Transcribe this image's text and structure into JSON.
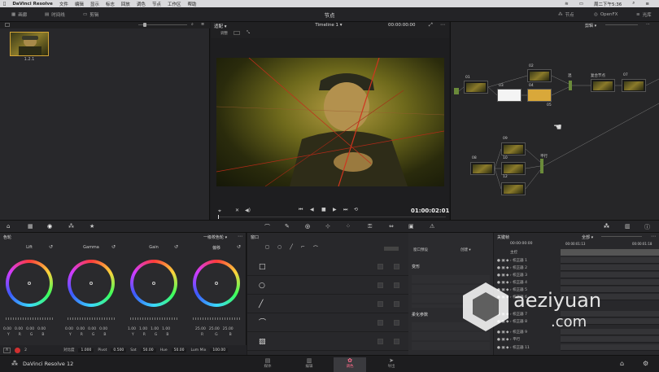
{
  "menubar": {
    "app": "DaVinci Resolve",
    "items": [
      "文件",
      "编辑",
      "显示",
      "标志",
      "回放",
      "调色",
      "节点",
      "工作区",
      "帮助"
    ],
    "clock": "周二下午5:36"
  },
  "topbar": {
    "media_pool": "画廊",
    "timeline": "时间线",
    "clips": "剪辑",
    "title": "节点",
    "nodes_btn": "节点",
    "openfx": "OpenFX",
    "library": "光库"
  },
  "gallery": {
    "thumb_label": "1.2.1"
  },
  "viewer": {
    "fit": "适配",
    "timeline_name": "Timeline 1",
    "timecode_top": "00:00:00:00",
    "timecode": "01:00:02:01",
    "clip_label": "调整"
  },
  "nodes_panel": {
    "mode": "剪辑",
    "labels": [
      "01",
      "02",
      "03",
      "04",
      "05",
      "06",
      "07",
      "08",
      "09",
      "10",
      "11",
      "12",
      "13"
    ],
    "text_labels": [
      "混",
      "复合节点",
      "平行"
    ]
  },
  "color_wheels": {
    "title": "色轮",
    "mode": "一级校色轮",
    "wheels": [
      {
        "name": "Lift",
        "vals": [
          "0.00",
          "0.00",
          "0.00",
          "0.00"
        ],
        "keys": [
          "Y",
          "R",
          "G",
          "B"
        ]
      },
      {
        "name": "Gamma",
        "vals": [
          "0.00",
          "0.00",
          "0.00",
          "0.00"
        ],
        "keys": [
          "Y",
          "R",
          "G",
          "B"
        ]
      },
      {
        "name": "Gain",
        "vals": [
          "1.00",
          "1.00",
          "1.00",
          "1.00"
        ],
        "keys": [
          "Y",
          "R",
          "G",
          "B"
        ]
      },
      {
        "name": "偏移",
        "vals": [
          "25.00",
          "25.00",
          "25.00"
        ],
        "keys": [
          "R",
          "G",
          "B"
        ]
      }
    ],
    "params": {
      "page_a": "A",
      "page_num": "2",
      "contrast_label": "对比度",
      "contrast": "1.000",
      "pivot_label": "Pivot",
      "pivot": "0.500",
      "sat_label": "Sat",
      "sat": "50.00",
      "hue_label": "Hue",
      "hue": "50.00",
      "lum_label": "Lum Mix",
      "lum": "100.00"
    }
  },
  "window_panel": {
    "title": "窗口",
    "transform": "变形",
    "softness": "柔化参数",
    "preset": "窗口预设",
    "create": "创建"
  },
  "keyframes": {
    "title": "关键帧",
    "filter": "全部",
    "tc_start": "00:00:00:00",
    "tc_a": "00:00:01:13",
    "tc_b": "00:00:01:18",
    "rows": [
      "主控",
      "校正器 1",
      "校正器 2",
      "校正器 3",
      "校正器 4",
      "校正器 5",
      "校正器 6",
      "校正器 7",
      "校正器 8",
      "校正器 9",
      "平行",
      "校正器 11"
    ]
  },
  "pagebar": {
    "app_name": "DaVinci Resolve 12",
    "tabs": [
      "媒体",
      "编辑",
      "调色",
      "导出"
    ],
    "active": 2
  },
  "watermark": {
    "brand": "aeziyuan",
    "tld": ".com"
  },
  "colors": {
    "accent": "#ff6b8a",
    "node_border": "#d4a536",
    "bg": "#1b1b1d"
  }
}
